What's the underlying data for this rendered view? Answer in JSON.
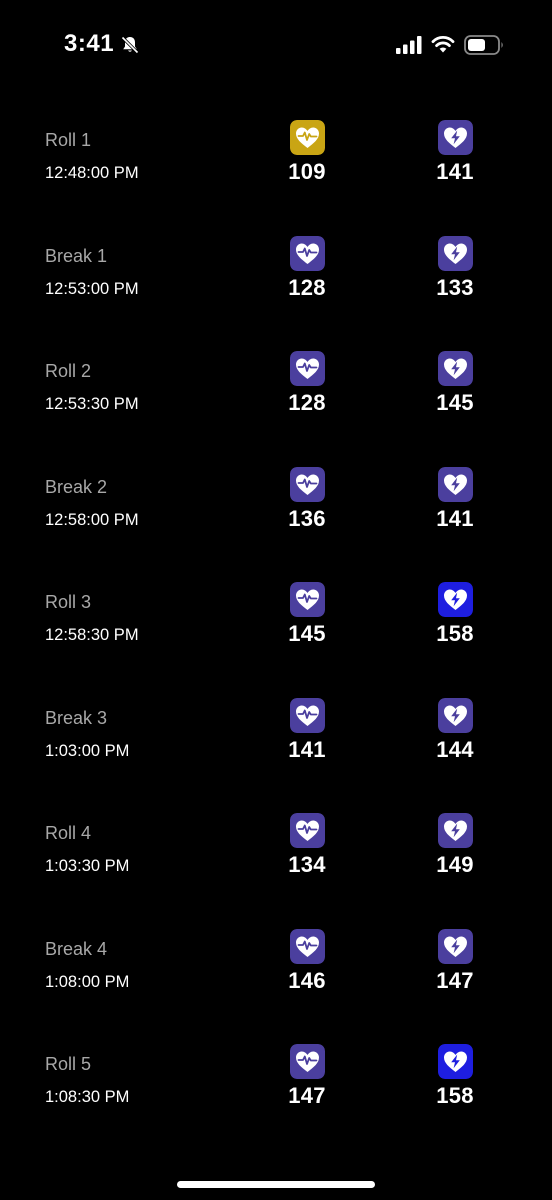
{
  "status_bar": {
    "time": "3:41",
    "icons": [
      "bell-slash-icon",
      "cellular-signal-icon",
      "wifi-icon",
      "battery-icon"
    ]
  },
  "colors": {
    "background": "#000000",
    "icon_default": "#4B3F9E",
    "icon_gold": "#C9A514",
    "icon_blue": "#1E1EE0",
    "label_gray": "#A8A8A8",
    "text_white": "#FFFFFF"
  },
  "rows": [
    {
      "label": "Roll 1",
      "time": "12:48:00 PM",
      "hr_value": "109",
      "hr_icon": "heart-pulse-icon",
      "hr_color": "#C9A514",
      "peak_value": "141",
      "peak_icon": "heart-bolt-icon",
      "peak_color": "#4B3F9E"
    },
    {
      "label": "Break 1",
      "time": "12:53:00 PM",
      "hr_value": "128",
      "hr_icon": "heart-pulse-icon",
      "hr_color": "#4B3F9E",
      "peak_value": "133",
      "peak_icon": "heart-bolt-icon",
      "peak_color": "#4B3F9E"
    },
    {
      "label": "Roll 2",
      "time": "12:53:30 PM",
      "hr_value": "128",
      "hr_icon": "heart-pulse-icon",
      "hr_color": "#4B3F9E",
      "peak_value": "145",
      "peak_icon": "heart-bolt-icon",
      "peak_color": "#4B3F9E"
    },
    {
      "label": "Break 2",
      "time": "12:58:00 PM",
      "hr_value": "136",
      "hr_icon": "heart-pulse-icon",
      "hr_color": "#4B3F9E",
      "peak_value": "141",
      "peak_icon": "heart-bolt-icon",
      "peak_color": "#4B3F9E"
    },
    {
      "label": "Roll 3",
      "time": "12:58:30 PM",
      "hr_value": "145",
      "hr_icon": "heart-pulse-icon",
      "hr_color": "#4B3F9E",
      "peak_value": "158",
      "peak_icon": "heart-bolt-icon",
      "peak_color": "#1E1EE0"
    },
    {
      "label": "Break 3",
      "time": "1:03:00 PM",
      "hr_value": "141",
      "hr_icon": "heart-pulse-icon",
      "hr_color": "#4B3F9E",
      "peak_value": "144",
      "peak_icon": "heart-bolt-icon",
      "peak_color": "#4B3F9E"
    },
    {
      "label": "Roll 4",
      "time": "1:03:30 PM",
      "hr_value": "134",
      "hr_icon": "heart-pulse-icon",
      "hr_color": "#4B3F9E",
      "peak_value": "149",
      "peak_icon": "heart-bolt-icon",
      "peak_color": "#4B3F9E"
    },
    {
      "label": "Break 4",
      "time": "1:08:00 PM",
      "hr_value": "146",
      "hr_icon": "heart-pulse-icon",
      "hr_color": "#4B3F9E",
      "peak_value": "147",
      "peak_icon": "heart-bolt-icon",
      "peak_color": "#4B3F9E"
    },
    {
      "label": "Roll 5",
      "time": "1:08:30 PM",
      "hr_value": "147",
      "hr_icon": "heart-pulse-icon",
      "hr_color": "#4B3F9E",
      "peak_value": "158",
      "peak_icon": "heart-bolt-icon",
      "peak_color": "#1E1EE0"
    }
  ]
}
